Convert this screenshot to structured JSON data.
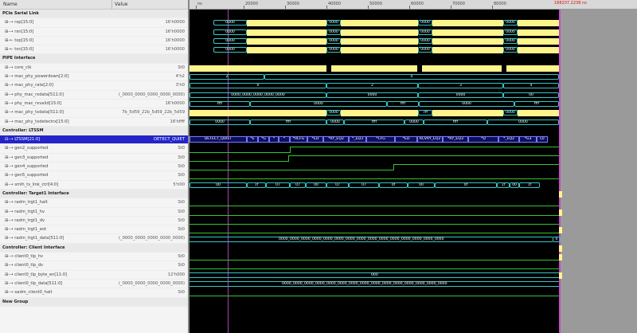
{
  "columns": {
    "name": "Name",
    "value": "Value"
  },
  "rows": [
    {
      "kind": "group",
      "name": "PCIe Serial Link",
      "value": ""
    },
    {
      "kind": "sig",
      "name": "⊞-→ rxp[15:0]",
      "value": "16'h0000"
    },
    {
      "kind": "sig",
      "name": "⊞-→ rxn[15:0]",
      "value": "16'h0000"
    },
    {
      "kind": "sig",
      "name": "⊞-← txp[15:0]",
      "value": "16'h0000"
    },
    {
      "kind": "sig",
      "name": "⊞-← txn[15:0]",
      "value": "16'h0000"
    },
    {
      "kind": "group",
      "name": "PIPE Interface",
      "value": ""
    },
    {
      "kind": "sig",
      "name": "⊞-→ core_clk",
      "value": "St0"
    },
    {
      "kind": "sig",
      "name": "⊞-→ mac_phy_powerdown[2:0]",
      "value": "4'h2"
    },
    {
      "kind": "sig",
      "name": "⊞-→ mac_phy_rate[2:0]",
      "value": "3'h0"
    },
    {
      "kind": "sig",
      "name": "⊞-→ phy_mac_rxdata[511:0]",
      "value": "(_0000_0000_0000_0000_0000)"
    },
    {
      "kind": "sig",
      "name": "⊞-→ phy_mac_rxvalid[15:0]",
      "value": "16'h0000"
    },
    {
      "kind": "sig",
      "name": "⊞-→ mac_phy_txdata[511:0]",
      "value": "7b_5d59_22b_5d59_22b_5d59"
    },
    {
      "kind": "sig",
      "name": "⊞-→ mac_phy_txdetectrx[15:0]",
      "value": "16'hffff"
    },
    {
      "kind": "group",
      "name": "Controller: LTSSM",
      "value": ""
    },
    {
      "kind": "sel",
      "name": "⊟-→ LTSSM[21:0]",
      "value": "DETECT_QUIET"
    },
    {
      "kind": "sig",
      "name": "⊞-→ gen2_supported",
      "value": "St0"
    },
    {
      "kind": "sig",
      "name": "⊞-→ gen3_supported",
      "value": "St0"
    },
    {
      "kind": "sig",
      "name": "⊞-→ gen4_supported",
      "value": "St0"
    },
    {
      "kind": "sig",
      "name": "⊞-→ gen5_supported",
      "value": "St0"
    },
    {
      "kind": "sig",
      "name": "⊞-→ smlh_ts_link_ctrl[4:0]",
      "value": "5'h00"
    },
    {
      "kind": "group",
      "name": "Controller: Target1 Interface",
      "value": ""
    },
    {
      "kind": "sig",
      "name": "⊞-→ radm_trgt1_halt",
      "value": "St0"
    },
    {
      "kind": "sig",
      "name": "⊞-→ radm_trgt1_hv",
      "value": "St0"
    },
    {
      "kind": "sig",
      "name": "⊞-→ radm_trgt1_dv",
      "value": "St0"
    },
    {
      "kind": "sig",
      "name": "⊞-→ radm_trgt1_eot",
      "value": "St0"
    },
    {
      "kind": "sig",
      "name": "⊞-→ radm_trgt1_data[511:0]",
      "value": "(_0000_0000_0000_0000_0000)"
    },
    {
      "kind": "group",
      "name": "Controller: Client Interface",
      "value": ""
    },
    {
      "kind": "sig",
      "name": "⊞-→ client0_tlp_hv",
      "value": "St0"
    },
    {
      "kind": "sig",
      "name": "⊞-→ client0_tlp_dv",
      "value": "St0"
    },
    {
      "kind": "sig",
      "name": "⊞-→ client0_tlp_byte_en[11:0]",
      "value": "12'h000"
    },
    {
      "kind": "sig",
      "name": "⊞-→ client0_tlp_data[511:0]",
      "value": "(_0000_0000_0000_0000_0000)"
    },
    {
      "kind": "sig",
      "name": "⊞-→ xadm_client0_halt",
      "value": "St0"
    },
    {
      "kind": "group",
      "name": "New Group",
      "value": ""
    }
  ],
  "ruler": {
    "ticks": [
      "ns",
      "20000",
      "30000",
      "40000",
      "50000",
      "60000",
      "70000",
      "80000"
    ],
    "cursor": "188207.2238 ns"
  },
  "waves": {
    "serial": [
      [
        {
          "t": "0000",
          "w": "b"
        },
        {
          "t": "",
          "w": "y"
        },
        {
          "t": "0000",
          "w": "b"
        },
        {
          "t": "",
          "w": "y"
        },
        {
          "t": "0000",
          "w": "b"
        },
        {
          "t": "",
          "w": "y"
        },
        {
          "t": "0000",
          "w": "b"
        },
        {
          "t": "",
          "w": "y"
        }
      ],
      [
        {
          "t": "0000",
          "w": "b"
        },
        {
          "t": "",
          "w": "y"
        },
        {
          "t": "0000",
          "w": "b"
        },
        {
          "t": "",
          "w": "y"
        },
        {
          "t": "0000",
          "w": "b"
        },
        {
          "t": "",
          "w": "y"
        },
        {
          "t": "0000",
          "w": "b"
        },
        {
          "t": "",
          "w": "y"
        }
      ],
      [
        {
          "t": "0000",
          "w": "b"
        },
        {
          "t": "",
          "w": "y"
        },
        {
          "t": "0000",
          "w": "b"
        },
        {
          "t": "",
          "w": "y"
        },
        {
          "t": "0000",
          "w": "b"
        },
        {
          "t": "",
          "w": "y"
        },
        {
          "t": "0000",
          "w": "b"
        },
        {
          "t": "",
          "w": "y"
        }
      ],
      [
        {
          "t": "0000",
          "w": "b"
        },
        {
          "t": "",
          "w": "y"
        },
        {
          "t": "0000",
          "w": "b"
        },
        {
          "t": "",
          "w": "y"
        },
        {
          "t": "0000",
          "w": "b"
        },
        {
          "t": "",
          "w": "y"
        },
        {
          "t": "0000",
          "w": "b"
        },
        {
          "t": "",
          "w": "y"
        }
      ]
    ],
    "powerdown": [
      "2",
      "0"
    ],
    "rate": [
      "0",
      "2",
      "3",
      "4"
    ],
    "rxdata": [
      "0000_0000_0000_0000_0000",
      "0000",
      "0000",
      "00"
    ],
    "rxvalid": [
      "ffff",
      "0000",
      "ffff",
      "0000",
      "ffff"
    ],
    "txdata": [
      "0000",
      "7ff",
      "0000",
      "000"
    ],
    "txdetect": [
      "0000",
      "ffff",
      "0000",
      "ffff",
      "0000",
      "ffff",
      "0000"
    ],
    "ltssm": [
      "DETECT_QUIET",
      "*E",
      "*G",
      "*",
      "*",
      "*RCFG",
      "*ED",
      "*RY_EQ2",
      "*_EQ3",
      "*CFG",
      "*ED",
      "RCVRY_EQ2",
      "*RY_EQ3",
      "*D",
      "*_EQ2",
      "*G3",
      "L0"
    ],
    "linkctrl": [
      "00",
      "1f",
      "07",
      "07",
      "00",
      "07",
      "07",
      "0f",
      "00",
      "0f",
      "1f",
      "00",
      "1f"
    ],
    "trgt_data": "0000_0000_0000_0000_0000_0000_0000_0000_0000_0000_0000_0000_0000_0000_0000",
    "trgt_tail": "0",
    "byte_en": "000",
    "client_data": "0000_0000_0000_0000_0000_0000_0000_0000_0000_0000_0000_0000_0000_0000_0000"
  }
}
